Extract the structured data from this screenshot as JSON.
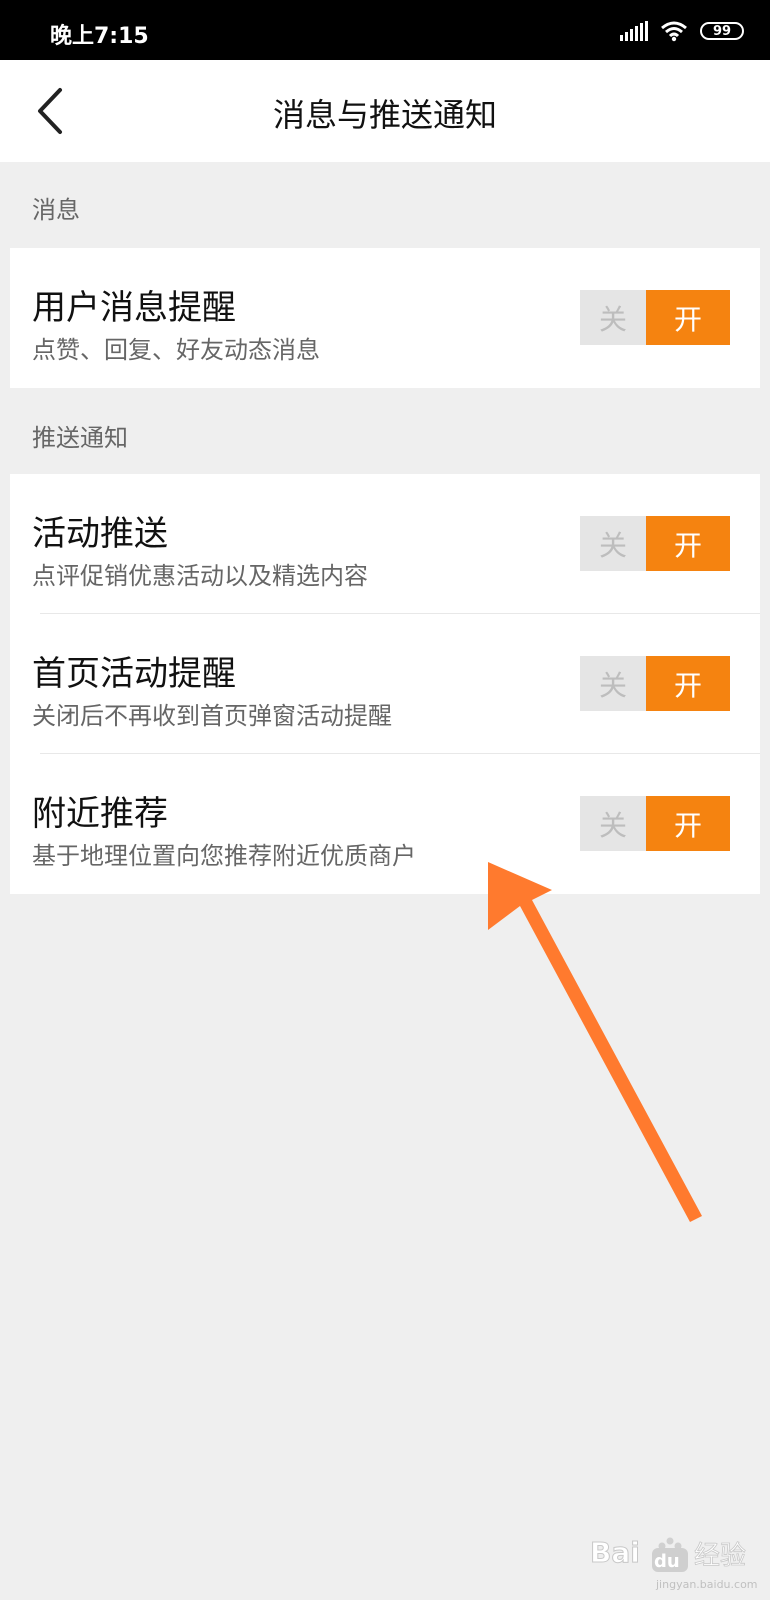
{
  "status_bar": {
    "time": "晚上7:15",
    "battery": "99"
  },
  "header": {
    "title": "消息与推送通知"
  },
  "sections": [
    {
      "label": "消息",
      "items": [
        {
          "title": "用户消息提醒",
          "subtitle": "点赞、回复、好友动态消息",
          "off_label": "关",
          "on_label": "开",
          "state": "on"
        }
      ]
    },
    {
      "label": "推送通知",
      "items": [
        {
          "title": "活动推送",
          "subtitle": "点评促销优惠活动以及精选内容",
          "off_label": "关",
          "on_label": "开",
          "state": "on"
        },
        {
          "title": "首页活动提醒",
          "subtitle": "关闭后不再收到首页弹窗活动提醒",
          "off_label": "关",
          "on_label": "开",
          "state": "on"
        },
        {
          "title": "附近推荐",
          "subtitle": "基于地理位置向您推荐附近优质商户",
          "off_label": "关",
          "on_label": "开",
          "state": "on"
        }
      ]
    }
  ],
  "watermark": {
    "brand_prefix": "Bai",
    "brand_suffix": "du",
    "brand_cn": "经验",
    "url": "jingyan.baidu.com"
  },
  "colors": {
    "accent": "#f58310",
    "arrow": "#ff7a2e",
    "background": "#efefef"
  }
}
